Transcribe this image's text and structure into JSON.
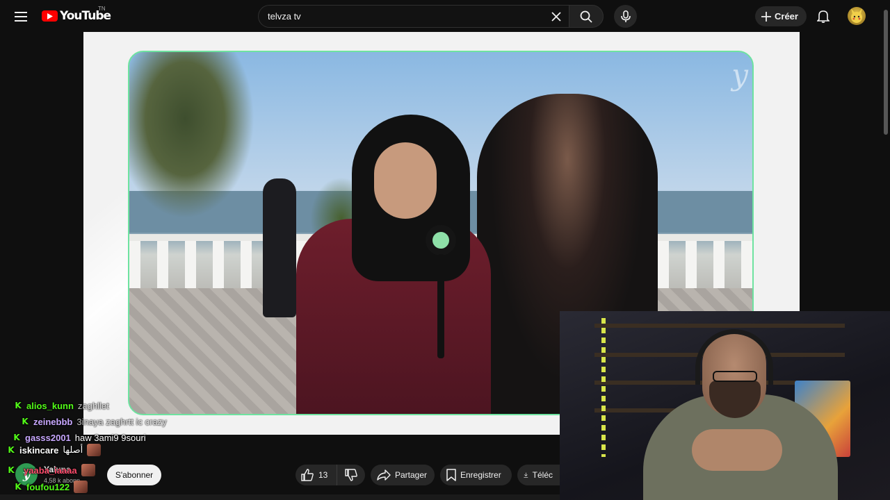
{
  "header": {
    "logo_text": "YouTube",
    "country_code": "TN",
    "search_value": "telvza tv",
    "create_label": "Créer"
  },
  "video": {
    "watermark": "y"
  },
  "channel": {
    "avatar_letter": "y",
    "name": "Yaluna",
    "subscribers": "4,58 k abonn"
  },
  "actions": {
    "subscribe_label": "S'abonner",
    "like_count": "13",
    "share_label": "Partager",
    "save_label": "Enregistrer",
    "download_label": "Téléc"
  },
  "chat": [
    {
      "user": "alios_kunn",
      "color": "#53fc18",
      "message": "zaghllet",
      "badge": "K"
    },
    {
      "user": "zeinebbb",
      "color": "#c8a8ff",
      "message": "3inaya zaghrtt ic crazy",
      "badge": "K"
    },
    {
      "user": "gasss2001",
      "color": "#c8a8ff",
      "message": "haw 3ami9 9souri",
      "badge": "K"
    },
    {
      "user": "iskincare",
      "color": "#ffffff",
      "message": "أصلها",
      "badge": "K"
    },
    {
      "user": "yaaba_iaaaa",
      "color": "#ff4d6d",
      "message": "",
      "badge": "K"
    },
    {
      "user": "foufou122",
      "color": "#53fc18",
      "message": "",
      "badge": "K"
    }
  ],
  "icons": {
    "menu": "hamburger-icon",
    "search": "search-icon",
    "clear": "close-icon",
    "mic": "mic-icon",
    "create": "plus-icon",
    "notifications": "bell-icon",
    "like": "thumbs-up-icon",
    "dislike": "thumbs-down-icon",
    "share": "share-arrow-icon",
    "save": "bookmark-icon",
    "download": "download-icon"
  }
}
